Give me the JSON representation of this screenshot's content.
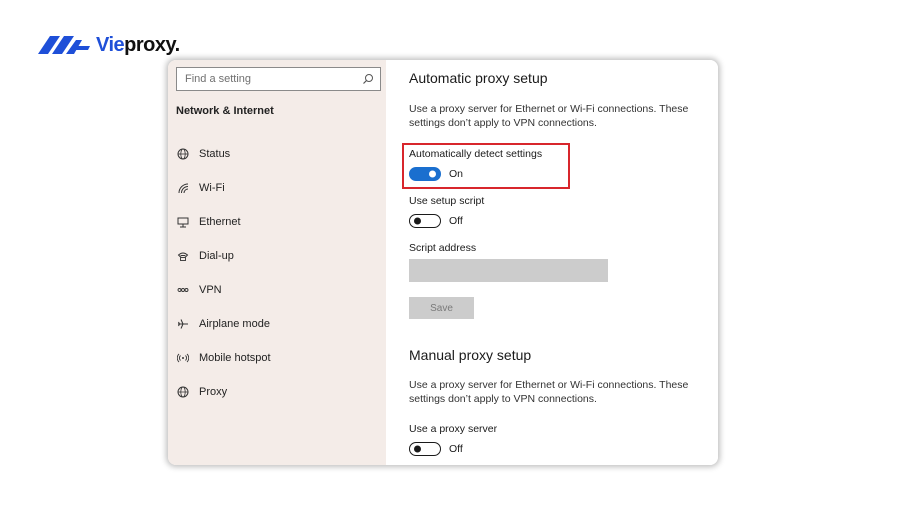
{
  "brand": {
    "name_a": "Vie",
    "name_b": "proxy."
  },
  "colors": {
    "accent": "#1a6fcf",
    "highlight": "#d8262c",
    "brand": "#1e4fd8",
    "sidebar_bg": "#f4ece8"
  },
  "sidebar": {
    "search_placeholder": "Find a setting",
    "section_title": "Network & Internet",
    "items": [
      {
        "label": "Status",
        "icon": "globe-icon"
      },
      {
        "label": "Wi-Fi",
        "icon": "wifi-icon"
      },
      {
        "label": "Ethernet",
        "icon": "ethernet-icon"
      },
      {
        "label": "Dial-up",
        "icon": "phone-icon"
      },
      {
        "label": "VPN",
        "icon": "vpn-icon"
      },
      {
        "label": "Airplane mode",
        "icon": "airplane-icon"
      },
      {
        "label": "Mobile hotspot",
        "icon": "hotspot-icon"
      },
      {
        "label": "Proxy",
        "icon": "globe-icon"
      }
    ]
  },
  "automatic": {
    "title": "Automatic proxy setup",
    "description": "Use a proxy server for Ethernet or Wi-Fi connections. These settings don’t apply to VPN connections.",
    "detect_label": "Automatically detect settings",
    "detect_state": "On",
    "script_label": "Use setup script",
    "script_state": "Off",
    "address_label": "Script address",
    "save_label": "Save"
  },
  "manual": {
    "title": "Manual proxy setup",
    "description": "Use a proxy server for Ethernet or Wi-Fi connections. These settings don’t apply to VPN connections.",
    "use_label": "Use a proxy server",
    "use_state": "Off"
  }
}
